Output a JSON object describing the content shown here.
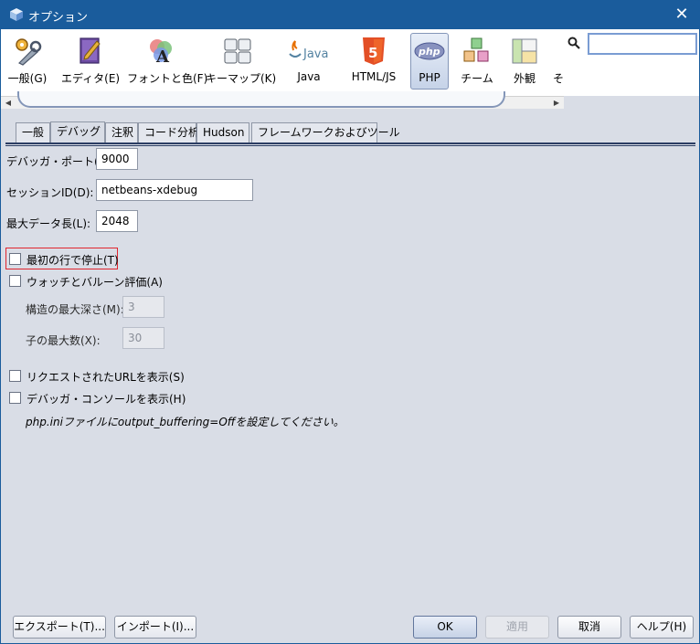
{
  "window": {
    "title": "オプション",
    "close_symbol": "✕"
  },
  "categories": [
    {
      "label": "一般(G)",
      "icon": "gears-icon"
    },
    {
      "label": "エディタ(E)",
      "icon": "editor-book-icon"
    },
    {
      "label": "フォントと色(F)",
      "icon": "fonts-colors-icon"
    },
    {
      "label": "キーマップ(K)",
      "icon": "keyboard-icon"
    },
    {
      "label": "Java",
      "icon": "java-icon"
    },
    {
      "label": "HTML/JS",
      "icon": "html5-icon"
    },
    {
      "label": "PHP",
      "icon": "php-icon"
    },
    {
      "label": "チーム",
      "icon": "team-cubes-icon"
    },
    {
      "label": "外観",
      "icon": "appearance-icon"
    },
    {
      "label": "そ",
      "icon": "misc-icon"
    }
  ],
  "search": {
    "value": ""
  },
  "tabs": [
    "一般",
    "デバッグ",
    "注釈",
    "コード分析",
    "Hudson",
    "フレームワークおよびツール"
  ],
  "debug": {
    "port_label": "デバッガ・ポート(G):",
    "port_value": "9000",
    "session_label": "セッションID(D):",
    "session_value": "netbeans-xdebug",
    "maxlen_label": "最大データ長(L):",
    "maxlen_value": "2048",
    "stop_first_line": "最初の行で停止(T)",
    "watch_eval": "ウォッチとバルーン評価(A)",
    "depth_label": "構造の最大深さ(M):",
    "depth_value": "3",
    "children_label": "子の最大数(X):",
    "children_value": "30",
    "show_urls": "リクエストされたURLを表示(S)",
    "show_console": "デバッガ・コンソールを表示(H)",
    "note": "php.iniファイルにoutput_buffering=Offを設定してください。"
  },
  "buttons": {
    "export": "エクスポート(T)...",
    "import": "インポート(I)...",
    "ok": "OK",
    "apply": "適用",
    "cancel": "取消",
    "help": "ヘルプ(H)"
  },
  "colors": {
    "titlebar": "#1a5c9c",
    "highlight": "#e0252e"
  }
}
